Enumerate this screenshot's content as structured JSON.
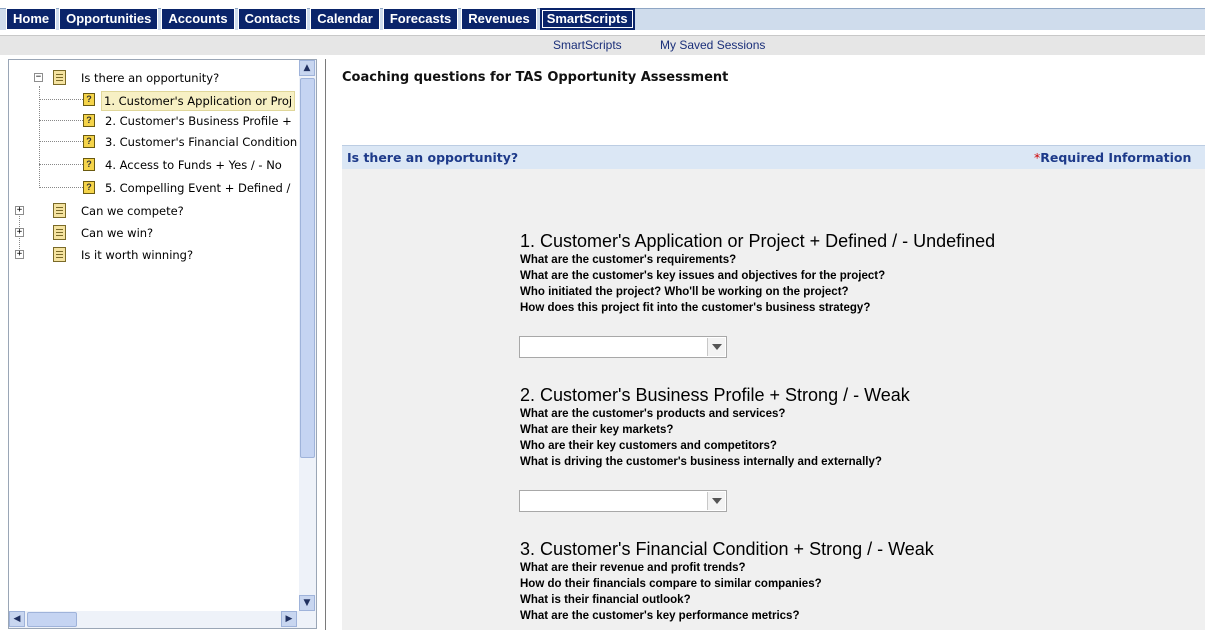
{
  "tabs": [
    "Home",
    "Opportunities",
    "Accounts",
    "Contacts",
    "Calendar",
    "Forecasts",
    "Revenues",
    "SmartScripts"
  ],
  "active_tab": "SmartScripts",
  "subnav": {
    "item1": "SmartScripts",
    "item2": "My Saved Sessions"
  },
  "tree": {
    "root1": "Is there an opportunity?",
    "children": [
      "1. Customer's Application or Proj",
      "2. Customer's Business Profile +",
      "3. Customer's Financial Condition",
      "4. Access to Funds  + Yes / - No",
      "5. Compelling Event + Defined /"
    ],
    "root2": "Can we compete?",
    "root3": "Can we win?",
    "root4": "Is it worth winning?"
  },
  "main": {
    "title": "Coaching questions for TAS Opportunity Assessment",
    "section_title": "Is there an opportunity?",
    "required_star": "*",
    "required_label": "Required Information"
  },
  "questions": [
    {
      "title": "1. Customer's Application or Project + Defined / - Undefined",
      "lines": [
        "What are the customer's requirements?",
        "What are the customer's key issues and objectives for the project?",
        "Who initiated the project? Who'll be working on the project?",
        "How does this project fit into the customer's business strategy?"
      ]
    },
    {
      "title": "2. Customer's Business Profile + Strong / - Weak",
      "lines": [
        "What are the customer's products and services?",
        "What are their key markets?",
        "Who are their key customers and competitors?",
        "What is driving the customer's business internally and externally?"
      ]
    },
    {
      "title": "3. Customer's Financial Condition + Strong / - Weak",
      "lines": [
        "What are their revenue and profit trends?",
        "How do their financials compare to similar companies?",
        "What is their financial outlook?",
        "What are the customer's key performance metrics?"
      ]
    }
  ],
  "colors": {
    "tab_bg": "#0a246a",
    "section_bg": "#dbe7f5",
    "link": "#1d3a8a",
    "required_star": "#d00000"
  }
}
